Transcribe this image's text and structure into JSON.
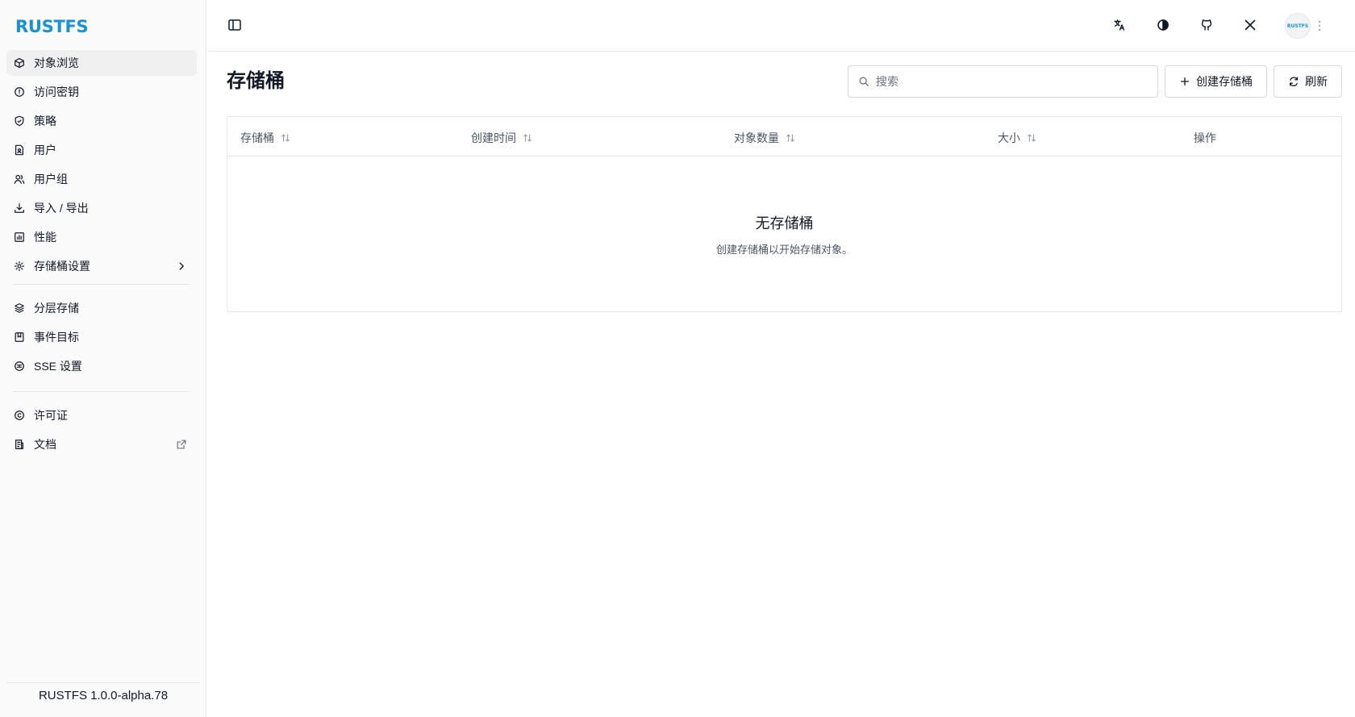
{
  "app": {
    "logo": "RUSTFS",
    "version": "RUSTFS 1.0.0-alpha.78",
    "accent": "#1593d4"
  },
  "sidebar": {
    "groups": [
      [
        {
          "label": "对象浏览",
          "icon": "box-icon",
          "active": true
        },
        {
          "label": "访问密钥",
          "icon": "key-icon"
        },
        {
          "label": "策略",
          "icon": "shield-icon"
        },
        {
          "label": "用户",
          "icon": "user-file-icon"
        },
        {
          "label": "用户组",
          "icon": "users-icon"
        },
        {
          "label": "导入 / 导出",
          "icon": "download-icon"
        },
        {
          "label": "性能",
          "icon": "chart-icon"
        },
        {
          "label": "存储桶设置",
          "icon": "gear-icon",
          "trailing": "chevron-right-icon"
        }
      ],
      [
        {
          "label": "分层存储",
          "icon": "layers-icon"
        },
        {
          "label": "事件目标",
          "icon": "bookmark-icon"
        },
        {
          "label": "SSE 设置",
          "icon": "database-icon"
        }
      ],
      [
        {
          "label": "许可证",
          "icon": "copyright-icon"
        },
        {
          "label": "文档",
          "icon": "document-icon",
          "trailing": "external-link-icon"
        }
      ]
    ]
  },
  "topbar": {
    "icons": [
      "sidebar-toggle-icon",
      "translate-icon",
      "theme-icon",
      "github-icon",
      "x-icon"
    ],
    "avatar_text": "RUSTFS"
  },
  "main": {
    "title": "存储桶",
    "search": {
      "placeholder": "搜索",
      "value": ""
    },
    "create_label": "创建存储桶",
    "refresh_label": "刷新",
    "table": {
      "columns": [
        "存储桶",
        "创建时间",
        "对象数量",
        "大小",
        "操作"
      ],
      "rows": [],
      "empty_title": "无存储桶",
      "empty_desc": "创建存储桶以开始存储对象。"
    }
  }
}
